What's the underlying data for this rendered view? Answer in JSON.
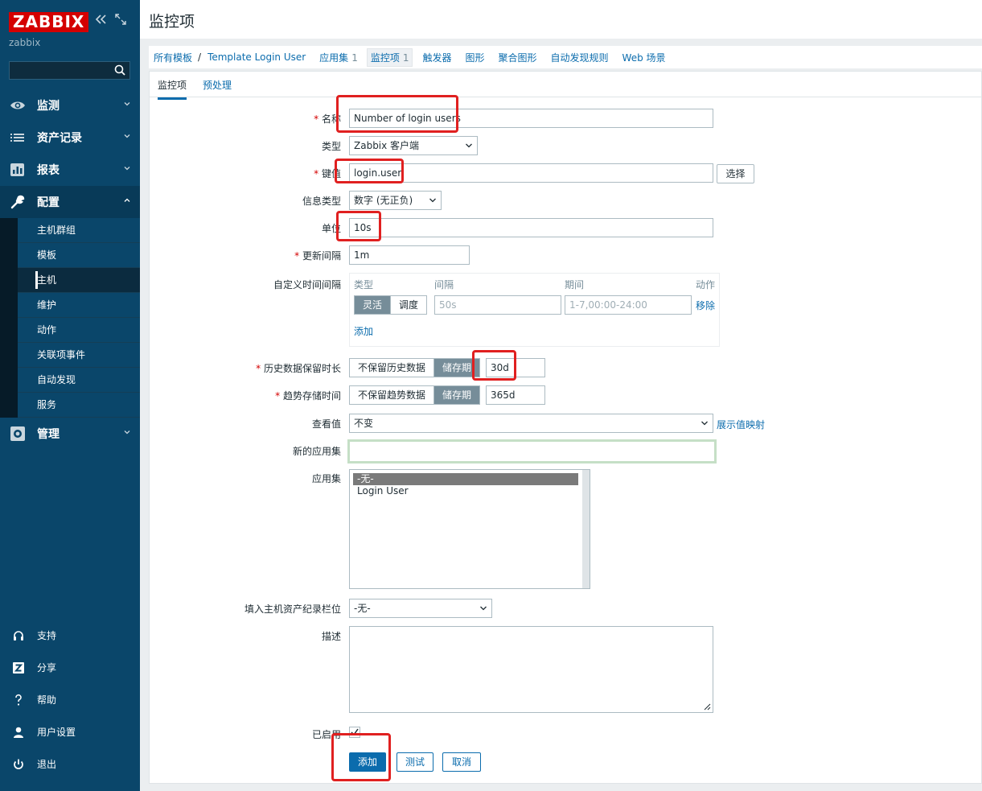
{
  "sidebar": {
    "logo": "ZABBIX",
    "server_name": "zabbix",
    "search_placeholder": "",
    "menu": [
      {
        "label": "监测",
        "icon": "eye-icon"
      },
      {
        "label": "资产记录",
        "icon": "list-icon"
      },
      {
        "label": "报表",
        "icon": "bar-chart-icon"
      },
      {
        "label": "配置",
        "icon": "wrench-icon"
      }
    ],
    "config_submenu": [
      "主机群组",
      "模板",
      "主机",
      "维护",
      "动作",
      "关联项事件",
      "自动发现",
      "服务"
    ],
    "admin_menu": {
      "label": "管理",
      "icon": "gear-icon"
    },
    "bottom": [
      {
        "label": "支持",
        "icon": "headset-icon"
      },
      {
        "label": "分享",
        "icon": "share-icon"
      },
      {
        "label": "帮助",
        "icon": "help-icon"
      },
      {
        "label": "用户设置",
        "icon": "user-icon"
      },
      {
        "label": "退出",
        "icon": "power-icon"
      }
    ]
  },
  "page": {
    "title": "监控项"
  },
  "breadcrumb": {
    "all_templates": "所有模板",
    "separator": "/",
    "template": "Template Login User",
    "applications": "应用集",
    "applications_count": "1",
    "items": "监控项",
    "items_count": "1",
    "triggers": "触发器",
    "graphs": "图形",
    "aggregate_graphs": "聚合图形",
    "discovery": "自动发现规则",
    "web": "Web 场景"
  },
  "tabs": {
    "item": "监控项",
    "preprocessing": "预处理"
  },
  "form": {
    "name_label": "名称",
    "name_value": "Number of login users",
    "type_label": "类型",
    "type_value": "Zabbix 客户端",
    "key_label": "键值",
    "key_value": "login.user",
    "select_button": "选择",
    "info_type_label": "信息类型",
    "info_type_value": "数字 (无正负)",
    "units_label": "单位",
    "units_value": "10s",
    "update_label": "更新间隔",
    "update_value": "1m",
    "custom_intervals_label": "自定义时间间隔",
    "ci_col_type": "类型",
    "ci_col_interval": "间隔",
    "ci_col_period": "期间",
    "ci_col_action": "动作",
    "ci_flexible": "灵活",
    "ci_scheduling": "调度",
    "ci_interval_placeholder": "50s",
    "ci_period_placeholder": "1-7,00:00-24:00",
    "ci_remove": "移除",
    "ci_add": "添加",
    "history_label": "历史数据保留时长",
    "history_no_keep": "不保留历史数据",
    "history_storage": "储存期",
    "history_value": "30d",
    "trend_label": "趋势存储时间",
    "trend_no_keep": "不保留趋势数据",
    "trend_storage": "储存期",
    "trend_value": "365d",
    "show_value_label": "查看值",
    "show_value_value": "不变",
    "show_value_mapping": "展示值映射",
    "new_app_label": "新的应用集",
    "new_app_value": "",
    "apps_label": "应用集",
    "apps_options": [
      "-无-",
      "Login User"
    ],
    "inventory_label": "填入主机资产纪录栏位",
    "inventory_value": "-无-",
    "desc_label": "描述",
    "enabled_label": "已启用",
    "add_button": "添加",
    "test_button": "测试",
    "cancel_button": "取消"
  },
  "colors": {
    "sidebar": "#0a466a",
    "accent": "#0b6cad",
    "logo": "#d40000",
    "highlight": "#e02020"
  }
}
